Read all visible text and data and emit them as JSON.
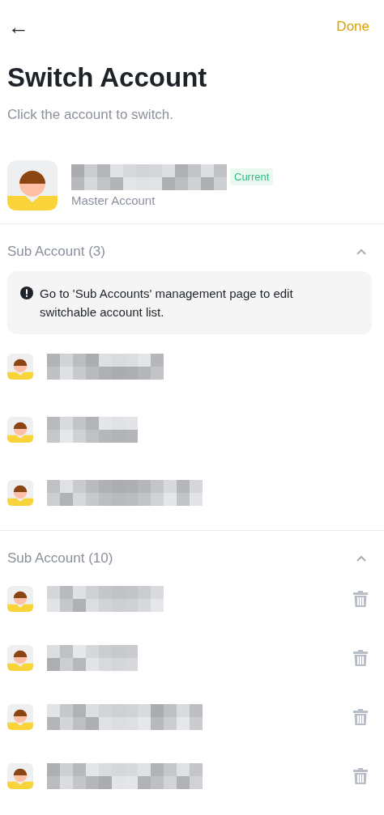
{
  "header": {
    "back": "←",
    "done": "Done"
  },
  "title": "Switch Account",
  "subtitle": "Click the account to switch.",
  "master": {
    "badge": "Current",
    "role": "Master Account"
  },
  "groups": [
    {
      "title": "Sub Account (3)",
      "expanded": true,
      "notice": "Go to 'Sub Accounts' management page to edit switchable account list.",
      "deletable": false,
      "accounts": [
        {
          "kind": "redacted"
        },
        {
          "kind": "redacted"
        },
        {
          "kind": "redacted"
        }
      ]
    },
    {
      "title": "Sub Account (10)",
      "expanded": true,
      "deletable": true,
      "accounts": [
        {
          "kind": "redacted"
        },
        {
          "kind": "redacted"
        },
        {
          "kind": "redacted"
        },
        {
          "kind": "redacted"
        }
      ]
    }
  ]
}
